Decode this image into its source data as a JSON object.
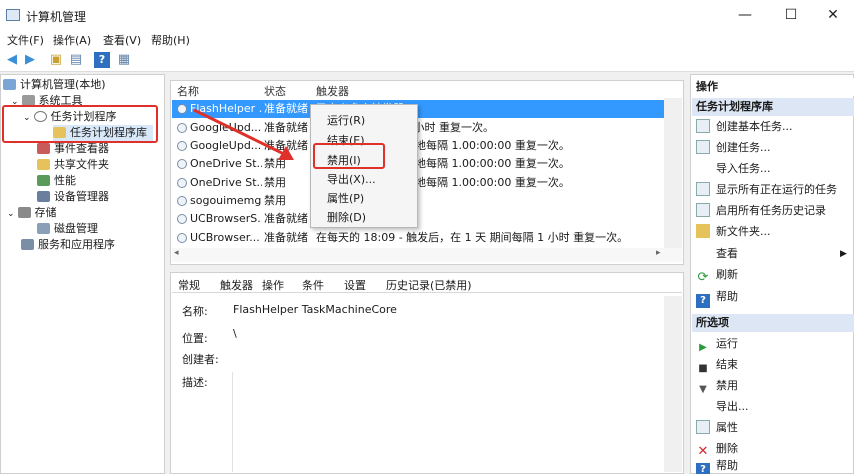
{
  "window": {
    "title": "计算机管理",
    "minimize": "—",
    "maximize": "☐",
    "close": "✕"
  },
  "menu": [
    "文件(F)",
    "操作(A)",
    "查看(V)",
    "帮助(H)"
  ],
  "toolbar_icons": [
    "back-arrow-icon",
    "forward-arrow-icon",
    "folder-up-icon",
    "console-tree-icon",
    "help-icon",
    "properties-icon"
  ],
  "tree": [
    {
      "label": "计算机管理(本地)",
      "icon": "computer-icon"
    },
    {
      "label": "系统工具",
      "icon": "tools-icon"
    },
    {
      "label": "任务计划程序",
      "icon": "clock-icon"
    },
    {
      "label": "任务计划程序库",
      "icon": "folder-icon"
    },
    {
      "label": "事件查看器",
      "icon": "event-viewer-icon"
    },
    {
      "label": "共享文件夹",
      "icon": "shared-folder-icon"
    },
    {
      "label": "性能",
      "icon": "performance-icon"
    },
    {
      "label": "设备管理器",
      "icon": "device-manager-icon"
    },
    {
      "label": "存储",
      "icon": "storage-icon"
    },
    {
      "label": "磁盘管理",
      "icon": "disk-icon"
    },
    {
      "label": "服务和应用程序",
      "icon": "services-icon"
    }
  ],
  "table": {
    "headers": [
      "名称",
      "状态",
      "触发器"
    ],
    "rows": [
      {
        "name": "FlashHelper ...",
        "status": "准备就绪",
        "trigger": "已定义多个触发器"
      },
      {
        "name": "GoogleUpd...",
        "status": "准备就绪",
        "trigger": "在 1 天 期间每隔 1 小时 重复一次。"
      },
      {
        "name": "GoogleUpd...",
        "status": "准备就绪",
        "trigger": "时 - 触发后，无限期地每隔 1.00:00:00 重复一次。"
      },
      {
        "name": "OneDrive St...",
        "status": "禁用",
        "trigger": "时 - 触发后，无限期地每隔 1.00:00:00 重复一次。"
      },
      {
        "name": "OneDrive St...",
        "status": "禁用",
        "trigger": "时 - 触发后，无限期地每隔 1.00:00:00 重复一次。"
      },
      {
        "name": "sogouimemgr",
        "status": "禁用",
        "trigger": ""
      },
      {
        "name": "UCBrowserS...",
        "status": "准备就绪",
        "trigger": ""
      },
      {
        "name": "UCBrowser...",
        "status": "准备就绪",
        "trigger": "在每天的 18:09 - 触发后，在 1 天 期间每隔 1 小时 重复一次。"
      }
    ]
  },
  "context_menu": [
    "运行(R)",
    "结束(E)",
    "禁用(I)",
    "导出(X)...",
    "属性(P)",
    "删除(D)"
  ],
  "tabs": [
    "常规",
    "触发器",
    "操作",
    "条件",
    "设置",
    "历史记录(已禁用)"
  ],
  "details": {
    "name_label": "名称:",
    "name_value": "FlashHelper TaskMachineCore",
    "location_label": "位置:",
    "location_value": "\\",
    "author_label": "创建者:",
    "description_label": "描述:"
  },
  "actions": {
    "header": "操作",
    "section1": "任务计划程序库",
    "items1": [
      {
        "label": "创建基本任务...",
        "icon": "create-basic-task-icon"
      },
      {
        "label": "创建任务...",
        "icon": "create-task-icon"
      },
      {
        "label": "导入任务...",
        "icon": ""
      },
      {
        "label": "显示所有正在运行的任务",
        "icon": "running-tasks-icon"
      },
      {
        "label": "启用所有任务历史记录",
        "icon": "history-icon"
      },
      {
        "label": "新文件夹...",
        "icon": "new-folder-icon"
      },
      {
        "label": "查看",
        "icon": ""
      },
      {
        "label": "刷新",
        "icon": "refresh-icon"
      },
      {
        "label": "帮助",
        "icon": "help-icon"
      }
    ],
    "section2": "所选项",
    "items2": [
      {
        "label": "运行",
        "icon": "run-icon"
      },
      {
        "label": "结束",
        "icon": "stop-icon"
      },
      {
        "label": "禁用",
        "icon": "disable-icon"
      },
      {
        "label": "导出...",
        "icon": ""
      },
      {
        "label": "属性",
        "icon": "properties-icon"
      },
      {
        "label": "删除",
        "icon": "delete-icon"
      },
      {
        "label": "帮助",
        "icon": "help-icon"
      }
    ]
  },
  "colors": {
    "selection": "#3399ff",
    "highlight_red": "#e0302b",
    "section_header": "#dce6f4"
  }
}
